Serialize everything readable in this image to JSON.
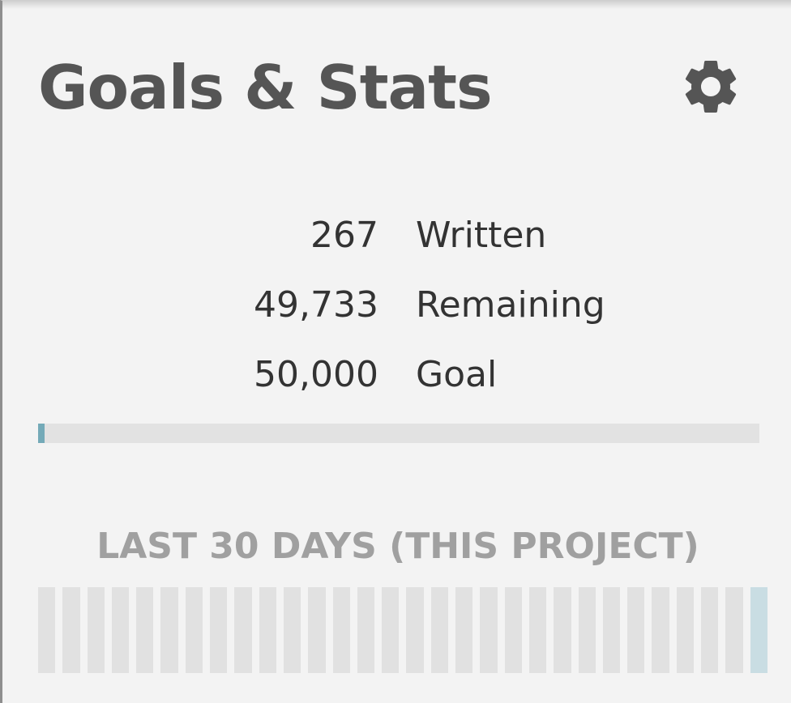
{
  "panel": {
    "title": "Goals & Stats",
    "settings_icon": "gear-icon"
  },
  "stats": [
    {
      "value": "267",
      "label": "Written"
    },
    {
      "value": "49,733",
      "label": "Remaining"
    },
    {
      "value": "50,000",
      "label": "Goal"
    }
  ],
  "progress": {
    "fraction": 0.00534,
    "fill_color": "#74aab8",
    "track_color": "#e2e2e2"
  },
  "history": {
    "heading": "LAST 30 DAYS (THIS PROJECT)",
    "days": [
      0,
      0,
      0,
      0,
      0,
      0,
      0,
      0,
      0,
      0,
      0,
      0,
      0,
      0,
      0,
      0,
      0,
      0,
      0,
      0,
      0,
      0,
      0,
      0,
      0,
      0,
      0,
      0,
      0,
      1
    ],
    "bar_color": "#e1e1e1",
    "active_bar_color": "#c9dde3"
  }
}
